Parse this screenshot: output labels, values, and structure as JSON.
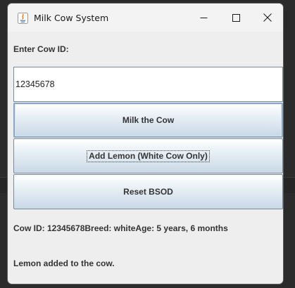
{
  "window": {
    "title": "Milk Cow System",
    "icon": "java-icon",
    "controls": [
      "minimize-icon",
      "maximize-icon",
      "close-icon"
    ]
  },
  "form": {
    "cow_id_label": "Enter Cow ID:",
    "cow_id_value": "12345678",
    "buttons": {
      "milk": "Milk the Cow",
      "lemon": "Add Lemon (White Cow Only)",
      "reset": "Reset BSOD"
    },
    "focused_button": "lemon"
  },
  "output": {
    "cow_info": "Cow ID: 12345678Breed: whiteAge: 5 years, 6 months",
    "status": "Lemon added to the cow."
  },
  "colors": {
    "window_bg": "#eeeeee",
    "button_top": "#ffffff",
    "button_bottom": "#c9d8e6",
    "button_border": "#7a8a99"
  }
}
